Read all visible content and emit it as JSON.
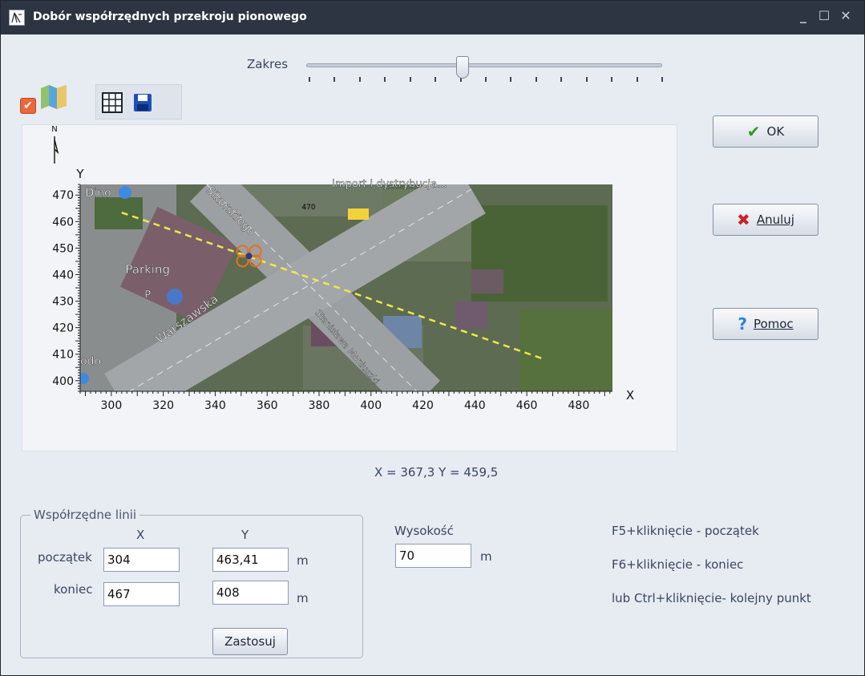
{
  "window": {
    "title": "Dobór współrzędnych przekroju pionowego",
    "controls": {
      "minimize": "_",
      "maximize": "☐",
      "close": "✕"
    }
  },
  "range_slider": {
    "label": "Zakres",
    "value_fraction": 0.44,
    "tick_count": 15
  },
  "toolbar": {
    "map_visible": true,
    "buttons": [
      {
        "icon": "grid-icon"
      },
      {
        "icon": "save-icon"
      }
    ]
  },
  "chart_data": {
    "type": "scatter",
    "xlabel": "X",
    "ylabel": "Y",
    "north_label": "N",
    "xlim": [
      288,
      493
    ],
    "ylim": [
      396,
      474
    ],
    "xticks": [
      300,
      320,
      340,
      360,
      380,
      400,
      420,
      440,
      460,
      480
    ],
    "yticks": [
      400,
      410,
      420,
      430,
      440,
      450,
      460,
      470
    ],
    "section_line": {
      "x": [
        304,
        467
      ],
      "y": [
        463.41,
        408
      ]
    },
    "marker": {
      "x": 353,
      "y": 447
    },
    "map_labels": {
      "store": "Dino",
      "street1": "Sikorskiego",
      "street2": "Warszawska",
      "street3": "Stanisława Moniuszki",
      "parking": "Parking",
      "parking_sign": "P",
      "road_number": "470",
      "poi_top": "Import i dystrybucja...",
      "poi_left": "odo"
    },
    "colors": {
      "section_line": "#f2e64a",
      "marker": "#e2731e",
      "axis": "#222222"
    }
  },
  "cursor_readout": "X = 367,3   Y = 459,5",
  "actions": {
    "ok": {
      "label": "OK",
      "icon": "checkmark-icon",
      "color": "#2f9a2a"
    },
    "cancel": {
      "label": "Anuluj",
      "icon": "x-icon",
      "color": "#c9242a"
    },
    "help": {
      "label": "Pomoc",
      "icon": "question-icon",
      "color": "#2b84d3"
    }
  },
  "line_coords": {
    "group_title": "Współrzędne linii",
    "col_x": "X",
    "col_y": "Y",
    "start_label": "początek",
    "end_label": "koniec",
    "start_x": "304",
    "start_y": "463,41",
    "end_x": "467",
    "end_y": "408",
    "unit": "m",
    "apply_label": "Zastosuj"
  },
  "height": {
    "label": "Wysokość",
    "value": "70",
    "unit": "m"
  },
  "hints": {
    "start": "F5+kliknięcie - początek",
    "end": "F6+kliknięcie  - koniec",
    "next": "lub Ctrl+kliknięcie- kolejny punkt"
  }
}
